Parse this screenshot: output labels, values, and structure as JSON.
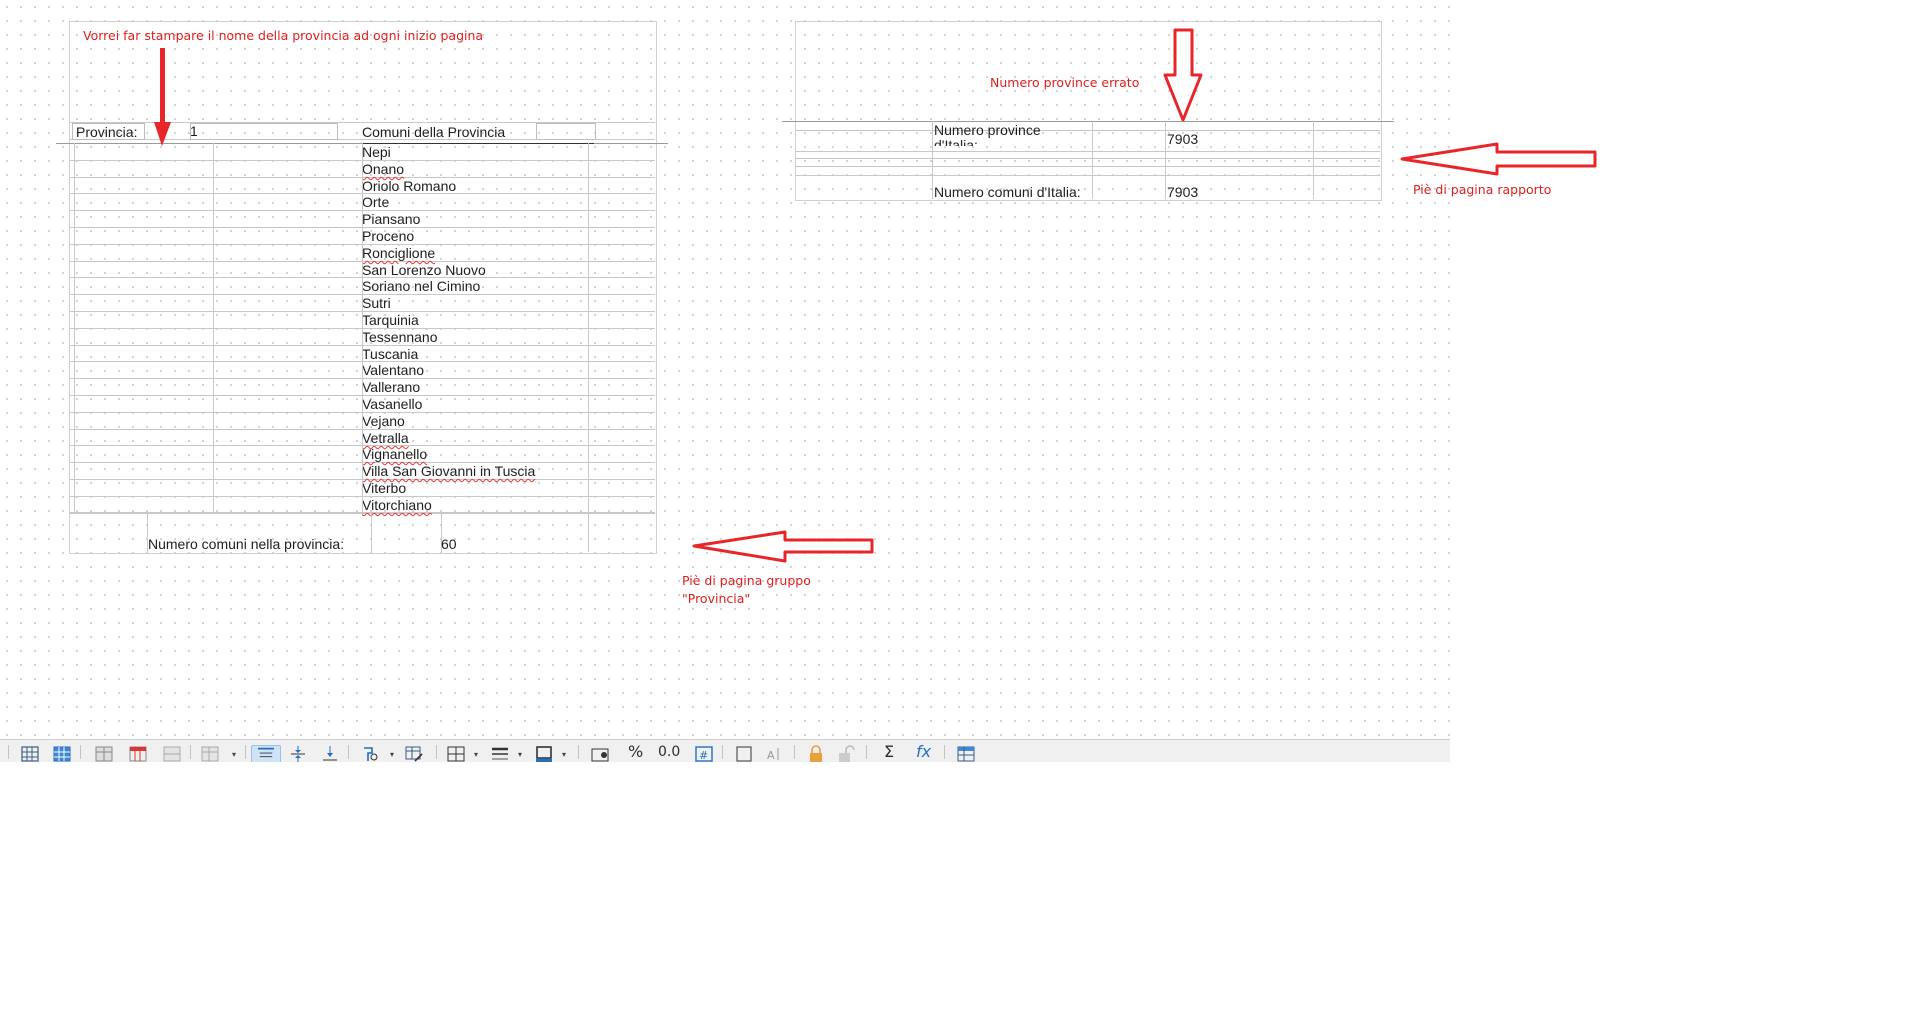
{
  "annotations": {
    "page_header_note": "Vorrei far stampare il nome della provincia ad ogni inizio pagina",
    "wrong_count_note": "Numero province errato",
    "group_footer_note_line1": "Piè di pagina gruppo",
    "group_footer_note_line2": "\"Provincia\"",
    "report_footer_note": "Piè di pagina rapporto"
  },
  "left_report": {
    "province_label": "Provincia:",
    "province_value": "1",
    "comuni_header": "Comuni della Provincia",
    "comuni": [
      "Nepi",
      "Onano",
      "Oriolo Romano",
      "Orte",
      "Piansano",
      "Proceno",
      "Ronciglione",
      "San Lorenzo Nuovo",
      "Soriano nel Cimino",
      "Sutri",
      "Tarquinia",
      "Tessennano",
      "Tuscania",
      "Valentano",
      "Vallerano",
      "Vasanello",
      "Vejano",
      "Vetralla",
      "Vignanello",
      "Villa San Giovanni in Tuscia",
      "Viterbo",
      "Vitorchiano"
    ],
    "group_footer_label": "Numero comuni nella provincia:",
    "group_footer_value": "60"
  },
  "right_report": {
    "province_count_label_line1": "Numero province",
    "province_count_label_line2": "d'Italia:",
    "province_count_value": "7903",
    "comuni_count_label": "Numero comuni d'Italia:",
    "comuni_count_value": "7903"
  },
  "colors": {
    "annotation_red": "#e01e1e",
    "arrow_red": "#e8262a",
    "toolbar_bg": "#f0f0f0",
    "toolbar_icon_blue": "#1f6fc5",
    "toolbar_icon_orange": "#e8a03a"
  },
  "toolbar": {
    "icons": [
      "grid-icon",
      "grid-blue-icon",
      "table-icon",
      "table-red-icon",
      "table-merge-icon",
      "table-insert-icon",
      "align-top-icon",
      "align-middle-icon",
      "align-bottom-icon",
      "format-paint-icon",
      "table-edit-icon",
      "borders-icon",
      "line-style-icon",
      "border-color-icon",
      "image-icon",
      "percent-icon",
      "infinity-icon",
      "number-format-icon",
      "frame-icon",
      "text-shrink-icon",
      "lock-icon",
      "unlock-icon",
      "sum-icon",
      "function-icon",
      "table-props-icon"
    ]
  }
}
